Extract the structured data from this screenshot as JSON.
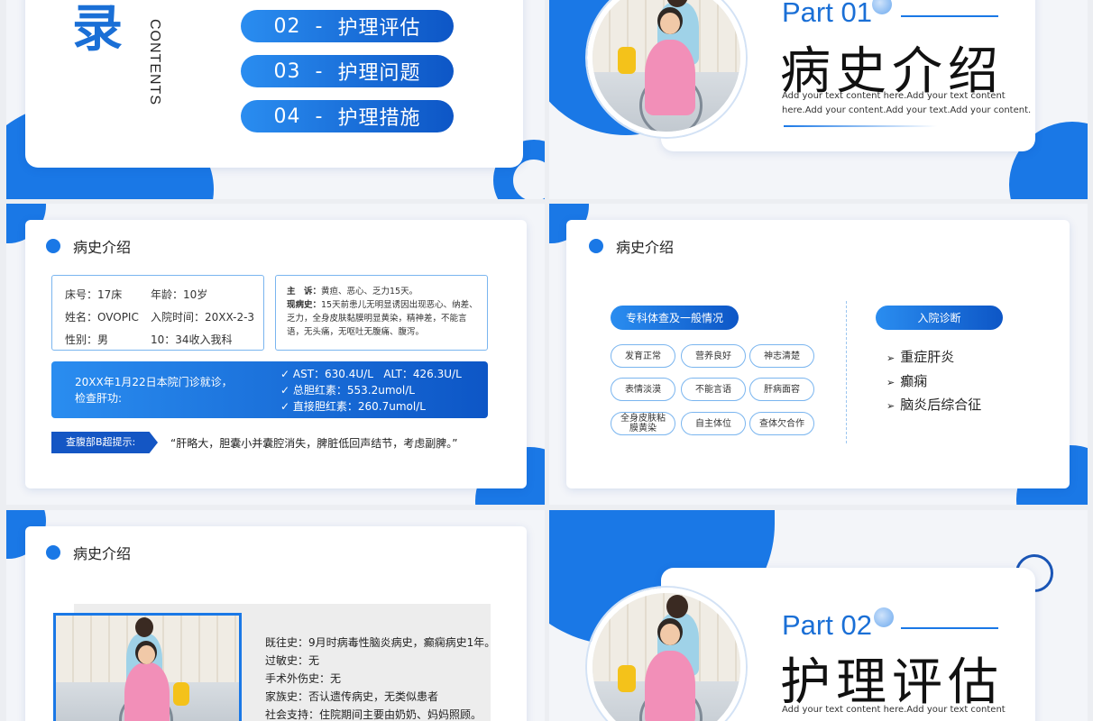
{
  "colors": {
    "accent": "#1a78e6",
    "accent_dark": "#0d56c6"
  },
  "slide1": {
    "title_char": "目录",
    "contents": "CONTENTS",
    "items": [
      {
        "num": "02",
        "sep": "-",
        "label": "护理评估"
      },
      {
        "num": "03",
        "sep": "-",
        "label": "护理问题"
      },
      {
        "num": "04",
        "sep": "-",
        "label": "护理措施"
      }
    ]
  },
  "slide2": {
    "part": "Part 01",
    "title": "病史介绍",
    "desc1": "Add your text content here.Add your text content",
    "desc2": "here.Add your content.Add your text.Add your content."
  },
  "slide3": {
    "section": "病史介绍",
    "info": [
      {
        "k": "床号：",
        "v": "17床",
        "k2": "年龄：",
        "v2": "10岁"
      },
      {
        "k": "姓名：",
        "v": "OVOPIC",
        "k2": "入院时间：",
        "v2": "20XX-2-3"
      },
      {
        "k": "性别：",
        "v": "男",
        "k2": "10：",
        "v2": "34收入我科"
      }
    ],
    "complaint_label": "主　诉：",
    "complaint": "黄疸、恶心、乏力15天。",
    "history_label": "现病史：",
    "history": "15天前患儿无明显诱因出现恶心、纳差、乏力，全身皮肤黏膜明显黄染，精神差，不能言语，无头痛，无呕吐无腹痛、腹泻。",
    "visit_line1": "20XX年1月22日本院门诊就诊，",
    "visit_line2": "检查肝功:",
    "labs": [
      "✓ AST：630.4U/L   ALT：426.3U/L",
      "✓ 总胆红素：553.2umol/L",
      "✓ 直接胆红素：260.7umol/L"
    ],
    "bscan_label": "查腹部B超提示:",
    "bscan": "“肝略大，胆囊小并囊腔消失，脾脏低回声结节，考虑副脾。”"
  },
  "slide4": {
    "section": "病史介绍",
    "exam_title": "专科体查及一般情况",
    "tags": [
      "发育正常",
      "营养良好",
      "神志清楚",
      "表情淡漠",
      "不能言语",
      "肝病面容",
      "全身皮肤粘膜黄染",
      "自主体位",
      "查体欠合作"
    ],
    "diag_title": "入院诊断",
    "diagnoses": [
      "重症肝炎",
      "癫痫",
      "脑炎后综合征"
    ]
  },
  "slide5": {
    "section": "病史介绍",
    "lines": [
      "既往史：9月时病毒性脑炎病史，癫痫病史1年。",
      "过敏史：无",
      "手术外伤史：无",
      "家族史：否认遗传病史，无类似患者",
      "社会支持：住院期间主要由奶奶、妈妈照顾。"
    ]
  },
  "slide6": {
    "part": "Part 02",
    "title": "护理评估",
    "desc1": "Add your text content here.Add your text content"
  }
}
